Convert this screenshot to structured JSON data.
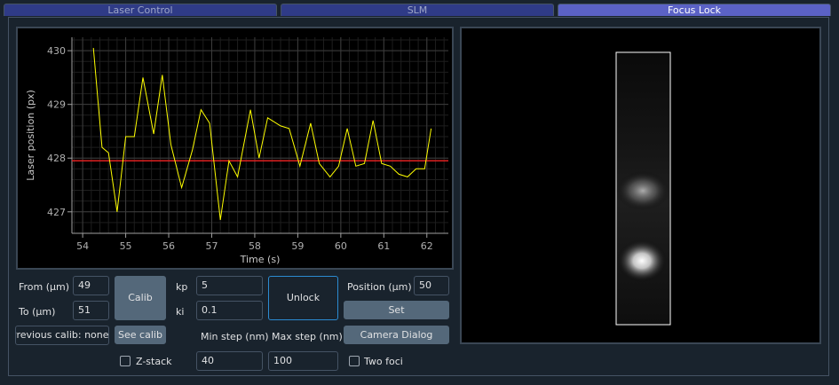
{
  "tabs": [
    "Laser Control",
    "SLM",
    "Focus Lock"
  ],
  "active_tab": "Focus Lock",
  "chart_data": {
    "type": "line",
    "xlabel": "Time (s)",
    "ylabel": "Laser position (px)",
    "xlim": [
      53.75,
      62.5
    ],
    "ylim": [
      426.6,
      430.25
    ],
    "xticks": [
      54,
      55,
      56,
      57,
      58,
      59,
      60,
      61,
      62
    ],
    "yticks": [
      427,
      428,
      429,
      430
    ],
    "grid": true,
    "colors": {
      "series": "#ffff00",
      "setpoint": "#e02020",
      "grid": "#3c3c3c",
      "axis": "#a0a0a0"
    },
    "setpoint": 427.95,
    "series": [
      {
        "x": [
          54.25,
          54.45,
          54.6,
          54.8,
          55.0,
          55.2,
          55.4,
          55.65,
          55.85,
          56.05,
          56.3,
          56.55,
          56.75,
          56.95,
          57.2,
          57.4,
          57.6,
          57.9,
          58.1,
          58.3,
          58.6,
          58.8,
          59.05,
          59.3,
          59.5,
          59.75,
          59.95,
          60.15,
          60.35,
          60.55,
          60.75,
          60.95,
          61.15,
          61.35,
          61.55,
          61.75,
          61.95,
          62.1
        ],
        "y": [
          430.05,
          428.2,
          428.1,
          427.0,
          428.4,
          428.4,
          429.5,
          428.45,
          429.55,
          428.25,
          427.45,
          428.15,
          428.9,
          428.65,
          426.85,
          427.95,
          427.65,
          428.9,
          428.0,
          428.75,
          428.6,
          428.55,
          427.85,
          428.65,
          427.9,
          427.65,
          427.85,
          428.55,
          427.85,
          427.9,
          428.7,
          427.9,
          427.85,
          427.7,
          427.65,
          427.8,
          427.8,
          428.55
        ]
      }
    ]
  },
  "camera": {
    "label": "Focus camera view"
  },
  "controls": {
    "from_label": "From (µm)",
    "from_value": "49",
    "to_label": "To (µm)",
    "to_value": "51",
    "calib_button": "Calib",
    "kp_label": "kp",
    "kp_value": "5",
    "ki_label": "ki",
    "ki_value": "0.1",
    "unlock_button": "Unlock",
    "position_label": "Position (µm)",
    "position_value": "50",
    "set_button": "Set",
    "previous_calib": "Previous calib: none",
    "see_calib_button": "See calib",
    "min_step_label": "Min step (nm)",
    "min_step_value": "40",
    "max_step_label": "Max step (nm)",
    "max_step_value": "100",
    "camera_dialog_button": "Camera Dialog",
    "zstack_label": "Z-stack",
    "zstack_checked": false,
    "two_foci_label": "Two foci",
    "two_foci_checked": false
  }
}
